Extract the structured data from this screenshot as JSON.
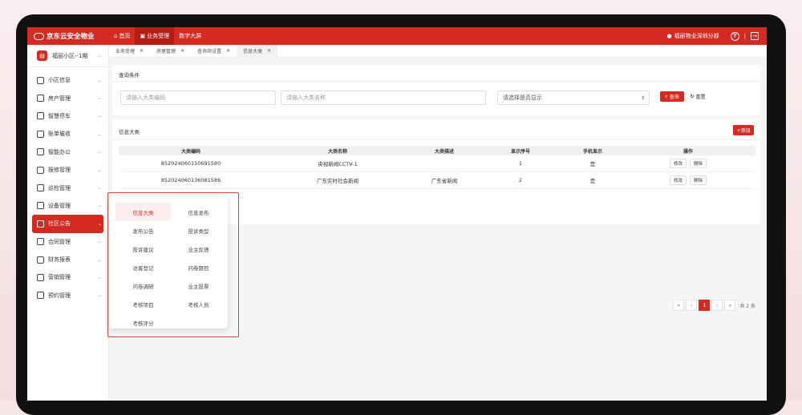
{
  "topbar": {
    "brand": "京东云安全物业",
    "nav": [
      {
        "label": "首页",
        "icon": "home-icon",
        "active": false
      },
      {
        "label": "业务受理",
        "icon": "monitor-icon",
        "active": true
      },
      {
        "label": "数字大屏",
        "icon": "",
        "active": false
      }
    ],
    "user": "福丽物业深圳分部",
    "separator": "|"
  },
  "sidebar": {
    "community": "福丽小区--1期",
    "items": [
      {
        "label": "小区信息",
        "active": false
      },
      {
        "label": "房产管理",
        "active": false
      },
      {
        "label": "智慧停车",
        "active": false
      },
      {
        "label": "账单催收",
        "active": false
      },
      {
        "label": "智能办公",
        "active": false
      },
      {
        "label": "报修管理",
        "active": false
      },
      {
        "label": "巡检管理",
        "active": false
      },
      {
        "label": "设备管理",
        "active": false
      },
      {
        "label": "社区公告",
        "active": true
      },
      {
        "label": "合同管理",
        "active": false
      },
      {
        "label": "财务报表",
        "active": false
      },
      {
        "label": "营销管理",
        "active": false
      },
      {
        "label": "预约管理",
        "active": false
      }
    ]
  },
  "tabs": [
    {
      "label": "业务受理",
      "active": false
    },
    {
      "label": "房屋管理",
      "active": false
    },
    {
      "label": "查询项设置",
      "active": false
    },
    {
      "label": "信息大类",
      "active": true
    }
  ],
  "query": {
    "title": "查询条件",
    "code_placeholder": "请输入大类编码",
    "name_placeholder": "请输入大类名称",
    "display_select": "请选择是否显示",
    "search_label": "查询",
    "reset_label": "重置"
  },
  "list": {
    "title": "信息大类",
    "add_label": "+添加",
    "columns": [
      "大类编码",
      "大类名称",
      "大类描述",
      "显示序号",
      "手机显示",
      "操作"
    ],
    "rows": [
      {
        "code": "852024060150691580",
        "name": "央视新闻CCTV-1",
        "desc": "",
        "order": "1",
        "mobile": "是"
      },
      {
        "code": "852024060136081586",
        "name": "广东实时社会新闻",
        "desc": "广东省新闻",
        "order": "2",
        "mobile": "是"
      }
    ],
    "edit_label": "修改",
    "delete_label": "删除"
  },
  "pager": {
    "first": "«",
    "prev": "‹",
    "current": "1",
    "next": "›",
    "last": "»",
    "total": "共 2 条"
  },
  "dropdown": {
    "items": [
      {
        "label": "信息大类",
        "active": true
      },
      {
        "label": "信息发布",
        "active": false
      },
      {
        "label": "发布公告",
        "active": false
      },
      {
        "label": "投诉类型",
        "active": false
      },
      {
        "label": "投诉建议",
        "active": false
      },
      {
        "label": "业主反馈",
        "active": false
      },
      {
        "label": "访客登记",
        "active": false
      },
      {
        "label": "问卷题目",
        "active": false
      },
      {
        "label": "问卷调研",
        "active": false
      },
      {
        "label": "业主投票",
        "active": false
      },
      {
        "label": "考核项目",
        "active": false
      },
      {
        "label": "考核人员",
        "active": false
      },
      {
        "label": "考核评分",
        "active": false
      }
    ]
  },
  "colors": {
    "accent": "#d42a22",
    "highlight_box": "#e1443d",
    "device_bezel": "#111111"
  }
}
